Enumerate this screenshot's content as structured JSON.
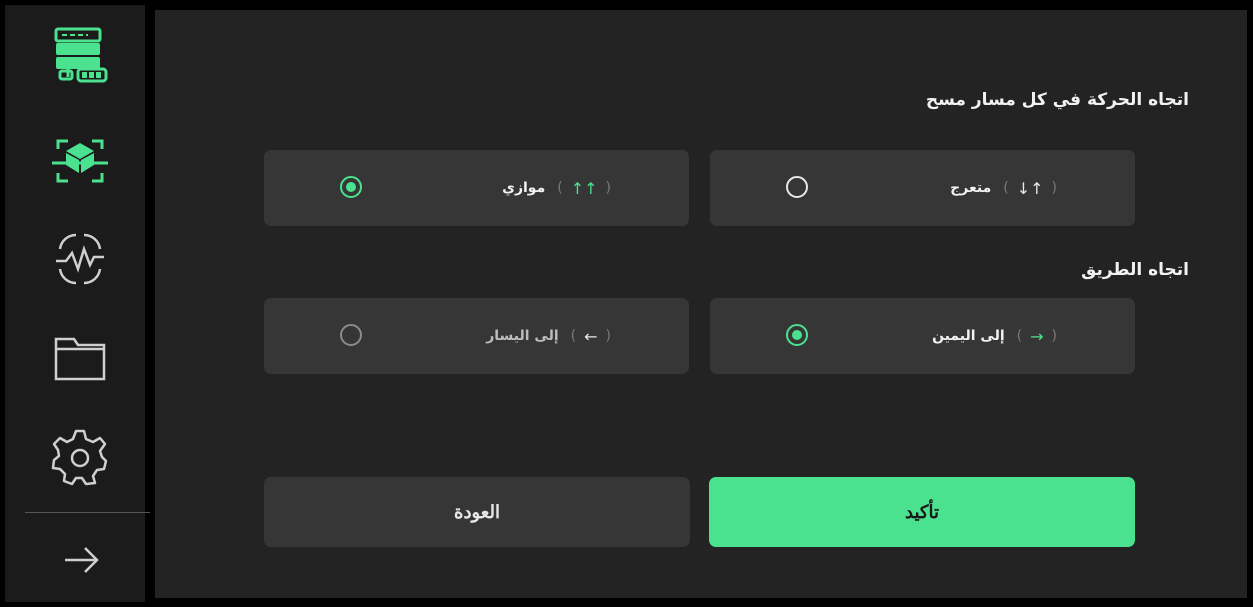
{
  "sidebar": {
    "items": [
      {
        "icon": "server-battery-icon",
        "active": true
      },
      {
        "icon": "scan-target-icon",
        "active": true
      },
      {
        "icon": "pulse-scan-icon",
        "active": false
      },
      {
        "icon": "folder-icon",
        "active": false
      },
      {
        "icon": "gear-icon",
        "active": false
      }
    ],
    "bottom_icon": "arrow-right-icon"
  },
  "movement": {
    "title": "اتجاه الحركة في كل مسار مسح",
    "options": [
      {
        "label": "متعرج",
        "symbol": "↑↓",
        "selected": false
      },
      {
        "label": "موازي",
        "symbol": "↑↑",
        "selected": true
      }
    ]
  },
  "road": {
    "title": "اتجاه الطريق",
    "options": [
      {
        "label": "إلى اليمين",
        "symbol": "→",
        "selected": true
      },
      {
        "label": "إلى اليسار",
        "symbol": "←",
        "selected": false
      }
    ]
  },
  "buttons": {
    "confirm": "تأكيد",
    "back": "العودة"
  },
  "paren_open": "(",
  "paren_close": ")",
  "colors": {
    "accent": "#4ae28f",
    "panel": "#363636",
    "background": "#232323",
    "sidebar": "#1b1b1b"
  }
}
